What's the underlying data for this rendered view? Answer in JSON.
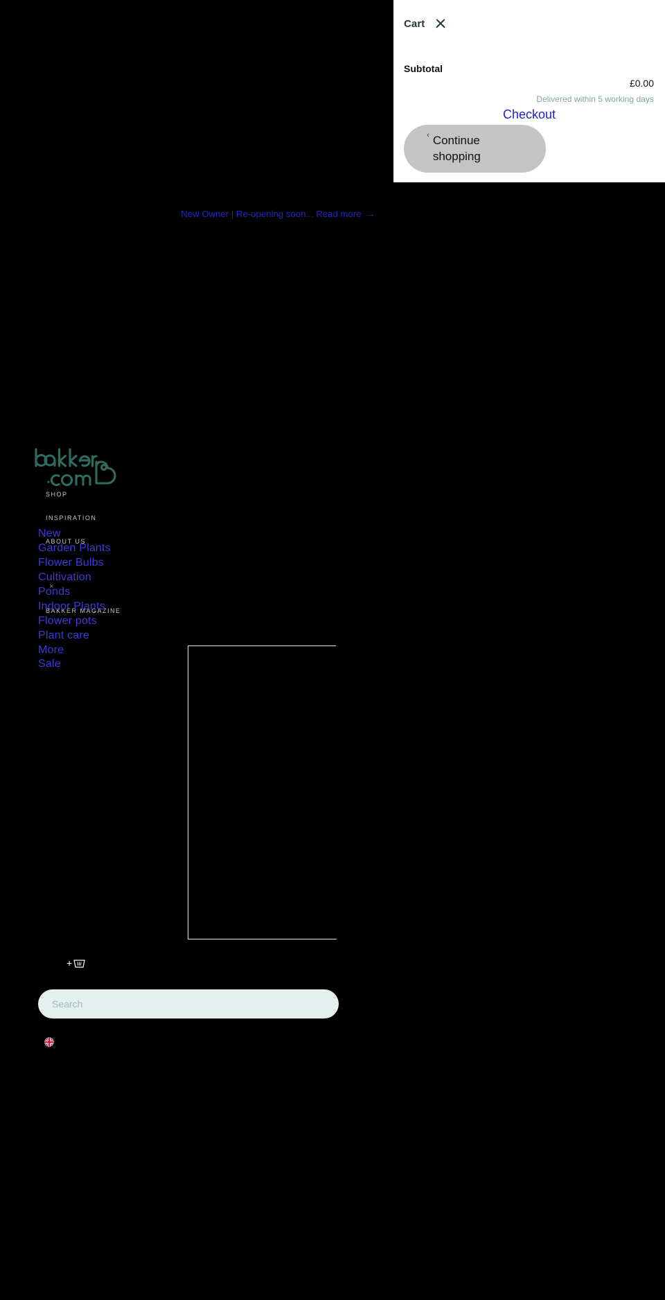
{
  "cart": {
    "title": "Cart",
    "close_icon": "close-icon",
    "subtotal_label": "Subtotal",
    "subtotal_amount": "£0.00",
    "delivery_note": "Delivered within 5 working days",
    "checkout_label": "Checkout",
    "continue_label": "Continue shopping",
    "continue_chevron": "‹"
  },
  "announcement": {
    "text": "New Owner | Re-opening soon... Read more",
    "arrow": "→"
  },
  "brand": {
    "name": "bakker.com",
    "line1": "bakker",
    "line2": ".com",
    "logo_color": "#2f6b5e"
  },
  "toplevel_nav": [
    {
      "label": "SHOP"
    },
    {
      "label": "INSPIRATION"
    },
    {
      "label": "ABOUT US"
    },
    {
      "label": "BAKKER MAGAZINE"
    }
  ],
  "main_menu": [
    {
      "label": "New"
    },
    {
      "label": "Garden Plants"
    },
    {
      "label": "Flower Bulbs"
    },
    {
      "label": "Cultivation"
    },
    {
      "label": "Ponds"
    },
    {
      "label": "Indoor Plants"
    },
    {
      "label": "Flower pots"
    },
    {
      "label": "Plant care"
    },
    {
      "label": "More"
    },
    {
      "label": "Sale"
    }
  ],
  "menu_marker": "×",
  "search": {
    "placeholder": "Search",
    "value": ""
  },
  "add_to_cart": {
    "plus": "+",
    "icon": "basket-icon"
  },
  "language": {
    "flag": "uk-flag"
  },
  "colors": {
    "background": "#000000",
    "drawer_bg": "#ffffff",
    "link_blue": "#3b3bd6",
    "brand_teal": "#2f6b5e",
    "search_bg": "#e4f0ee",
    "muted_teal": "#7da8a0",
    "button_grey": "#c4c4c4"
  }
}
